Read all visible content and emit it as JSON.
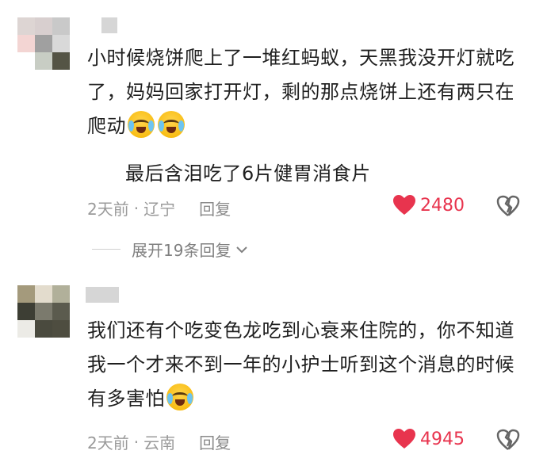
{
  "comments": [
    {
      "text_parts": [
        "小时候烧饼爬上了一堆红蚂蚁，天黑我没开灯就吃了，妈妈回家打开灯，剩的那点烧饼上还有两只在爬动"
      ],
      "emoji_count": 2,
      "emoji_name": "crying-laughing-emoji",
      "subtext": "最后含泪吃了6片健胃消食片",
      "time": "2天前",
      "location": "辽宁",
      "reply_label": "回复",
      "likes": "2480",
      "expand_label": "展开19条回复",
      "avatar_colors": [
        "#ddd5d3",
        "#d8cfcf",
        "#c9c9c9",
        "#f3d5d3",
        "#a0a0a0",
        "#d9d9d9",
        "#c8cdc4",
        "#545445",
        "#ffffff"
      ]
    },
    {
      "text_parts": [
        "我们还有个吃变色龙吃到心衰来住院的，你不知道我一个才来不到一年的小护士听到这个消息的时候有多害怕"
      ],
      "emoji_name": "crying-emoji",
      "time": "2天前",
      "location": "云南",
      "reply_label": "回复",
      "likes": "4945",
      "avatar_colors": [
        "#a49a7c",
        "#e3dccd",
        "#b1b09a",
        "#3d3e34",
        "#7b7a6d",
        "#5b5b4e",
        "#ecebe6",
        "#4a4a3e",
        "#4e4d40"
      ]
    }
  ],
  "colors": {
    "like_red": "#e8344e",
    "meta_gray": "#9a9a9a"
  },
  "icons": {
    "like": "heart-icon",
    "dislike": "broken-heart-icon",
    "expand": "chevron-down-icon"
  }
}
